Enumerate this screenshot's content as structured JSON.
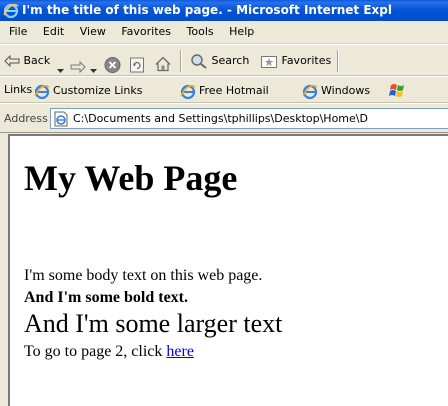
{
  "window": {
    "title": "I'm the title of this web page. - Microsoft Internet Expl"
  },
  "menu": [
    "File",
    "Edit",
    "View",
    "Favorites",
    "Tools",
    "Help"
  ],
  "toolbar": {
    "back_label": "Back",
    "search_label": "Search",
    "favorites_label": "Favorites"
  },
  "links": {
    "label": "Links",
    "items": [
      "Customize Links",
      "Free Hotmail",
      "Windows"
    ]
  },
  "address": {
    "label": "Address",
    "value": "C:\\Documents and Settings\\tphillips\\Desktop\\Home\\D"
  },
  "page": {
    "heading": "My Web Page",
    "body_text": "I'm some body text on this web page.",
    "bold_text": "And I'm some bold text.",
    "larger_text": "And I'm some larger text",
    "page2_prefix": "To go to page 2, click ",
    "page2_link": "here"
  },
  "colors": {
    "titlebar": "#0455d8",
    "chrome": "#ece9d8",
    "link": "#0000ee"
  }
}
